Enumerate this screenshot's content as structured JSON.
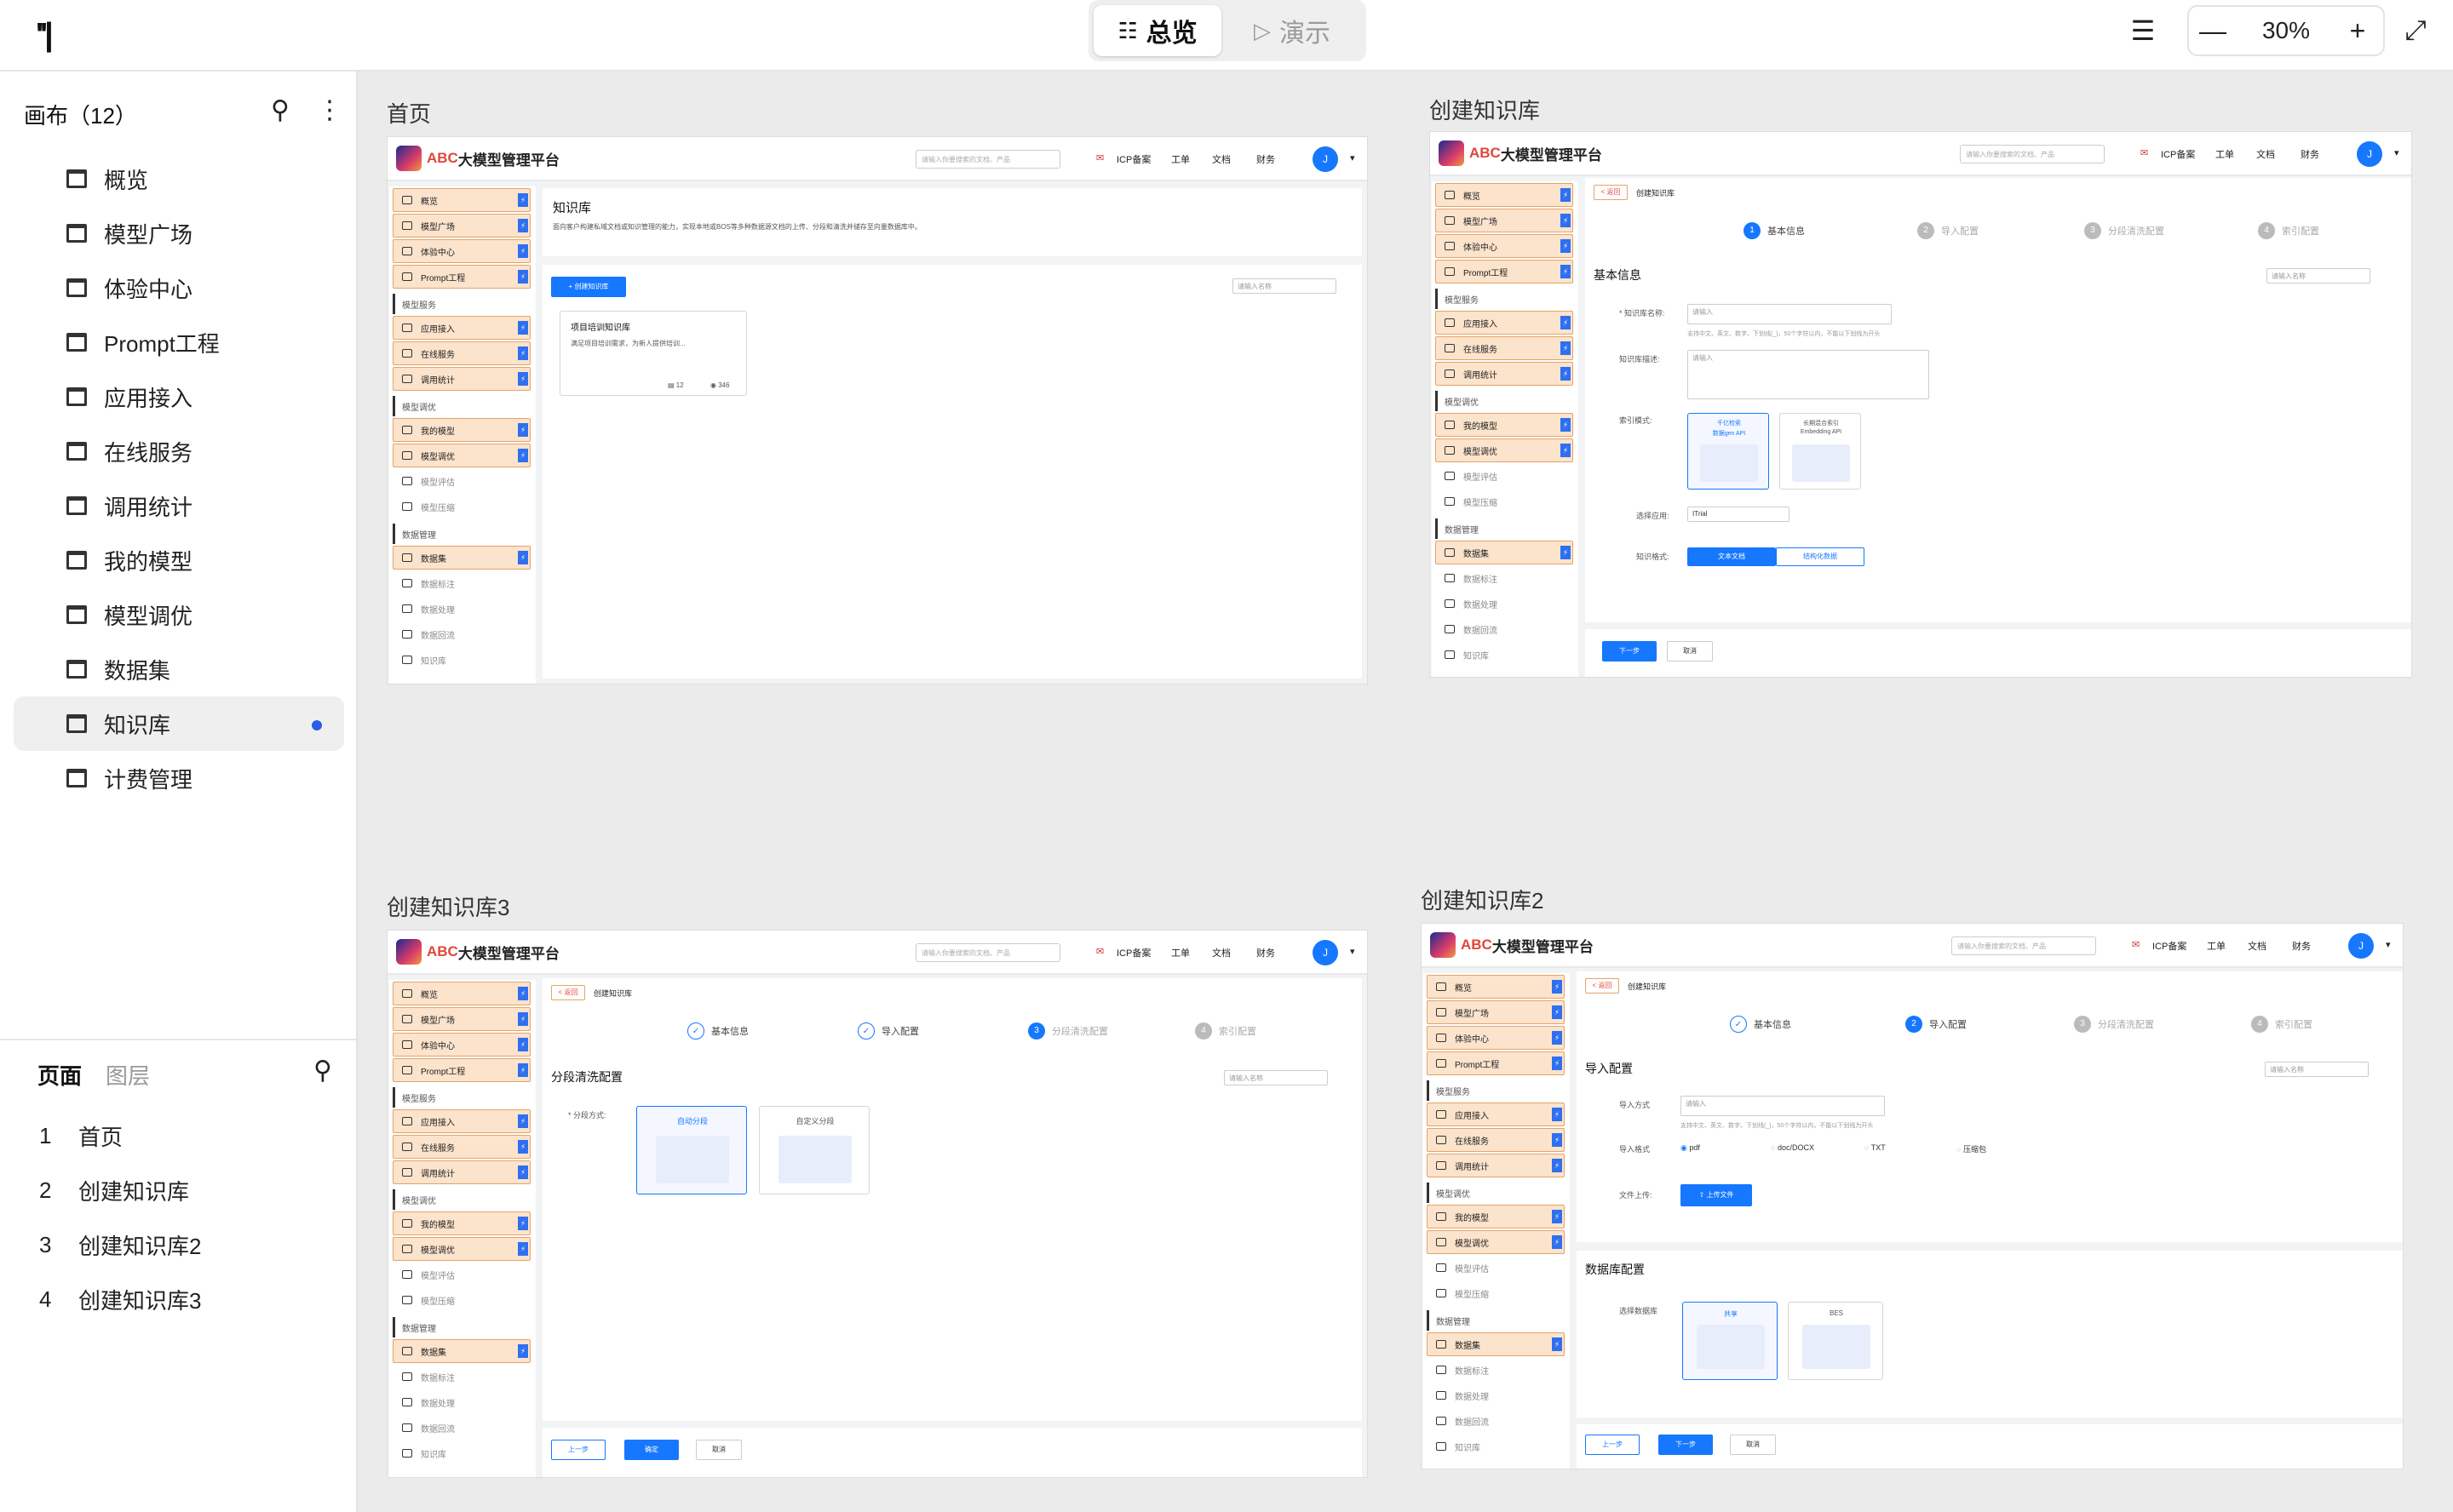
{
  "topbar": {
    "logo": "''|",
    "tab_overview": "总览",
    "tab_present": "演示",
    "zoom": "30%"
  },
  "sidebar": {
    "canvas_title": "画布（12）",
    "items": [
      {
        "label": "概览"
      },
      {
        "label": "模型广场"
      },
      {
        "label": "体验中心"
      },
      {
        "label": "Prompt工程"
      },
      {
        "label": "应用接入"
      },
      {
        "label": "在线服务"
      },
      {
        "label": "调用统计"
      },
      {
        "label": "我的模型"
      },
      {
        "label": "模型调优"
      },
      {
        "label": "数据集"
      },
      {
        "label": "知识库",
        "active": true
      },
      {
        "label": "计费管理"
      }
    ],
    "tab_pages": "页面",
    "tab_layers": "图层",
    "pages": [
      {
        "num": "1",
        "label": "首页"
      },
      {
        "num": "2",
        "label": "创建知识库"
      },
      {
        "num": "3",
        "label": "创建知识库2"
      },
      {
        "num": "4",
        "label": "创建知识库3"
      }
    ]
  },
  "app": {
    "brand_abc": "ABC",
    "brand_rest": "大模型管理平台",
    "search_placeholder": "请输入你要搜索的文档、产品",
    "nav": [
      "ICP备案",
      "工单",
      "文档",
      "财务"
    ],
    "avatar": "J",
    "menu": {
      "top": [
        "概览",
        "模型广场",
        "体验中心",
        "Prompt工程"
      ],
      "g1": "模型服务",
      "g1_items": [
        "应用接入",
        "在线服务",
        "调用统计"
      ],
      "g2": "模型调优",
      "g2_items": [
        "我的模型",
        "模型调优",
        "模型评估",
        "模型压缩"
      ],
      "g3": "数据管理",
      "g3_items": [
        "数据集",
        "数据标注",
        "数据处理",
        "数据回流",
        "知识库"
      ]
    }
  },
  "boards": {
    "home": {
      "label": "首页",
      "title": "知识库",
      "desc": "面向客户构建私域文档或知识管理的能力，实现本地或BOS等多种数据源文档的上传、分段和清洗并储存至向量数据库中。",
      "create_btn": "+ 创建知识库",
      "search": "请输入名称",
      "card_title": "项目培训知识库",
      "card_desc": "满足项目培训需求，为新人提供培训...",
      "card_files": "12",
      "card_views": "346"
    },
    "create1": {
      "label": "创建知识库",
      "back": "< 返回",
      "crumb": "创建知识库",
      "steps": [
        "基本信息",
        "导入配置",
        "分段清洗配置",
        "索引配置"
      ],
      "section": "基本信息",
      "search": "请输入名称",
      "name_label": "* 知识库名称:",
      "name_ph": "请输入",
      "name_hint": "支持中文、英文、数字、下划线(_)，50个字符以内，不能以下划线为开头",
      "desc_label": "知识库描述:",
      "desc_ph": "请输入",
      "index_label": "索引模式:",
      "opt1a": "千亿检索",
      "opt1b": "数据gen API",
      "opt2a": "长期混合索引",
      "opt2b": "Embedding API",
      "app_label": "选择应用:",
      "app_val": "ITrial",
      "fmt_label": "知识格式:",
      "fmt1": "文本文档",
      "fmt2": "结构化数据",
      "next": "下一步",
      "cancel": "取消"
    },
    "create2": {
      "label": "创建知识库2",
      "back": "< 返回",
      "crumb": "创建知识库",
      "steps": [
        "基本信息",
        "导入配置",
        "分段清洗配置",
        "索引配置"
      ],
      "section": "导入配置",
      "search": "请输入名称",
      "mode_label": "导入方式",
      "mode_ph": "请输入",
      "mode_hint": "支持中文、英文、数字、下划线(_)，50个字符以内，不能以下划线为开头",
      "fmt_label": "导入格式",
      "fmts": [
        "pdf",
        "doc/DOCX",
        "TXT",
        "压缩包"
      ],
      "upload_label": "文件上传:",
      "upload_btn": "上传文件",
      "db_section": "数据库配置",
      "db_label": "选择数据库",
      "db1": "共享",
      "db2": "BES",
      "prev": "上一步",
      "next": "下一步",
      "cancel": "取消"
    },
    "create3": {
      "label": "创建知识库3",
      "back": "< 返回",
      "crumb": "创建知识库",
      "steps": [
        "基本信息",
        "导入配置",
        "分段清洗配置",
        "索引配置"
      ],
      "section": "分段清洗配置",
      "search": "请输入名称",
      "split_label": "* 分段方式:",
      "opt1": "自动分段",
      "opt2": "自定义分段",
      "prev": "上一步",
      "ok": "确定",
      "cancel": "取消"
    }
  },
  "colors": {
    "accent": "#1677ff",
    "highlight": "#fbe3cc",
    "active_dot": "#2b5ce6"
  }
}
